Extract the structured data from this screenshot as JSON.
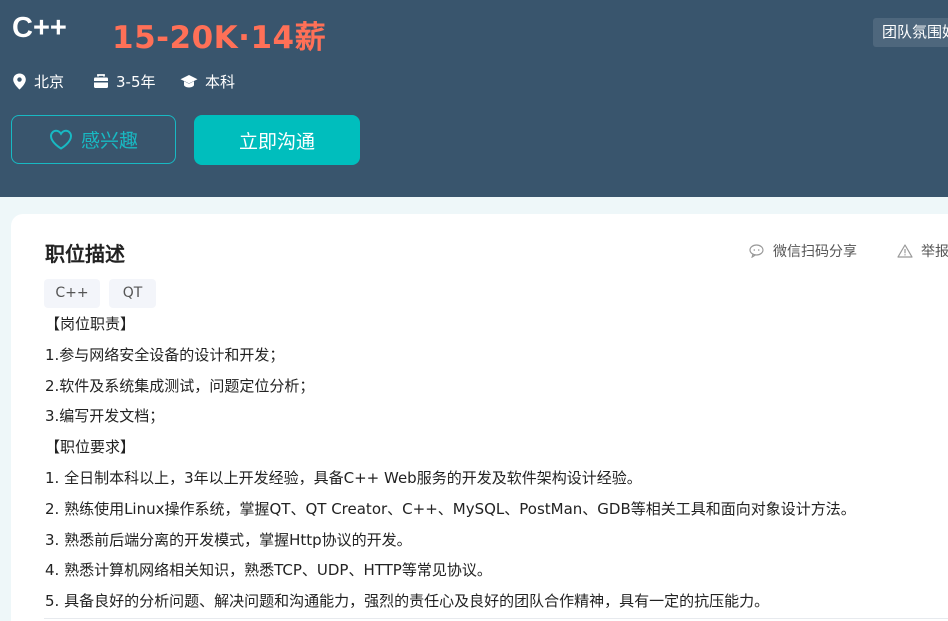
{
  "job": {
    "title": "C++",
    "salary": "15-20K·14薪",
    "team_tag": "团队氛围好",
    "city": "北京",
    "experience": "3-5年",
    "education": "本科"
  },
  "actions": {
    "interest_label": "感兴趣",
    "chat_label": "立即沟通"
  },
  "description": {
    "heading": "职位描述",
    "share_label": "微信扫码分享",
    "report_label": "举报",
    "tags": [
      "C++",
      "QT"
    ],
    "lines": [
      "【岗位职责】",
      "1.参与网络安全设备的设计和开发；",
      "2.软件及系统集成测试，问题定位分析；",
      "3.编写开发文档；",
      "【职位要求】",
      "1. 全日制本科以上，3年以上开发经验，具备C++ Web服务的开发及软件架构设计经验。",
      "2. 熟练使用Linux操作系统，掌握QT、QT Creator、C++、MySQL、PostMan、GDB等相关工具和面向对象设计方法。",
      "3. 熟悉前后端分离的开发模式，掌握Http协议的开发。",
      "4. 熟悉计算机网络相关知识，熟悉TCP、UDP、HTTP等常见协议。",
      "5. 具备良好的分析问题、解决问题和沟通能力，强烈的责任心及良好的团队合作精神，具有一定的抗压能力。"
    ]
  },
  "colors": {
    "header_bg": "#39556d",
    "salary": "#ff7057",
    "accent": "#00bebd"
  },
  "icons": [
    "location-icon",
    "briefcase-icon",
    "graduation-cap-icon",
    "heart-icon",
    "wechat-icon",
    "warning-icon"
  ]
}
